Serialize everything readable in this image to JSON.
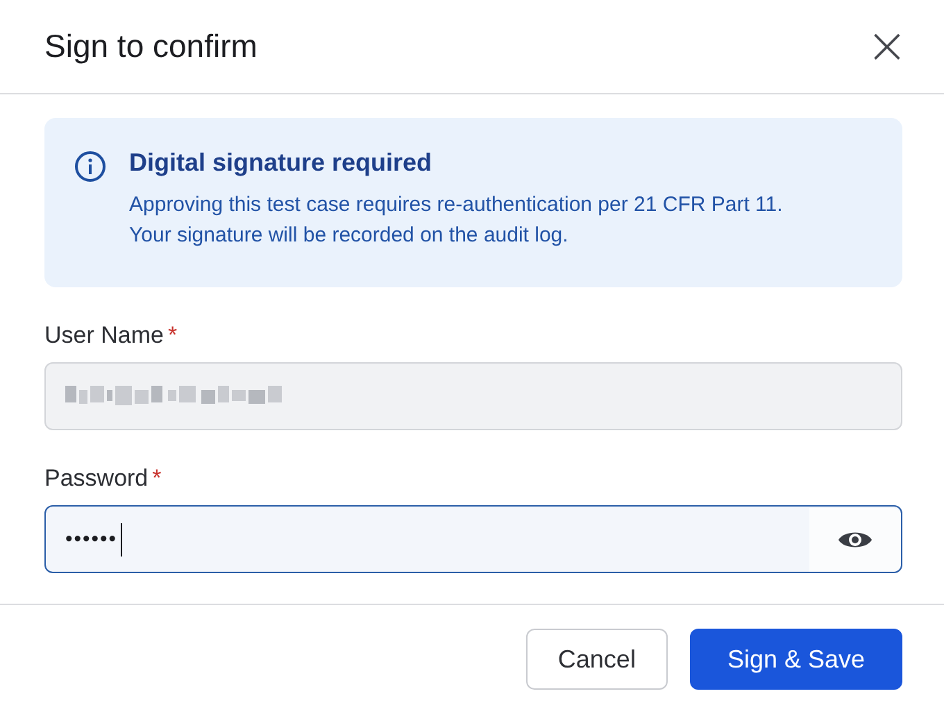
{
  "dialog": {
    "title": "Sign to confirm",
    "close": "×"
  },
  "notice": {
    "title": "Digital signature required",
    "body": [
      "Approving this test case requires re-authentication per 21 CFR Part 11.",
      "Your signature will be recorded on the audit log."
    ]
  },
  "fields": [
    {
      "kind": "redacted",
      "label": "User Name",
      "required_mark": "*",
      "focused": false
    },
    {
      "kind": "password",
      "label": "Password",
      "required_mark": "*",
      "value": "••••••",
      "focused": true
    }
  ],
  "buttons": [
    {
      "label": "Cancel",
      "kind": "secondary"
    },
    {
      "label": "Sign & Save",
      "kind": "primary"
    }
  ]
}
